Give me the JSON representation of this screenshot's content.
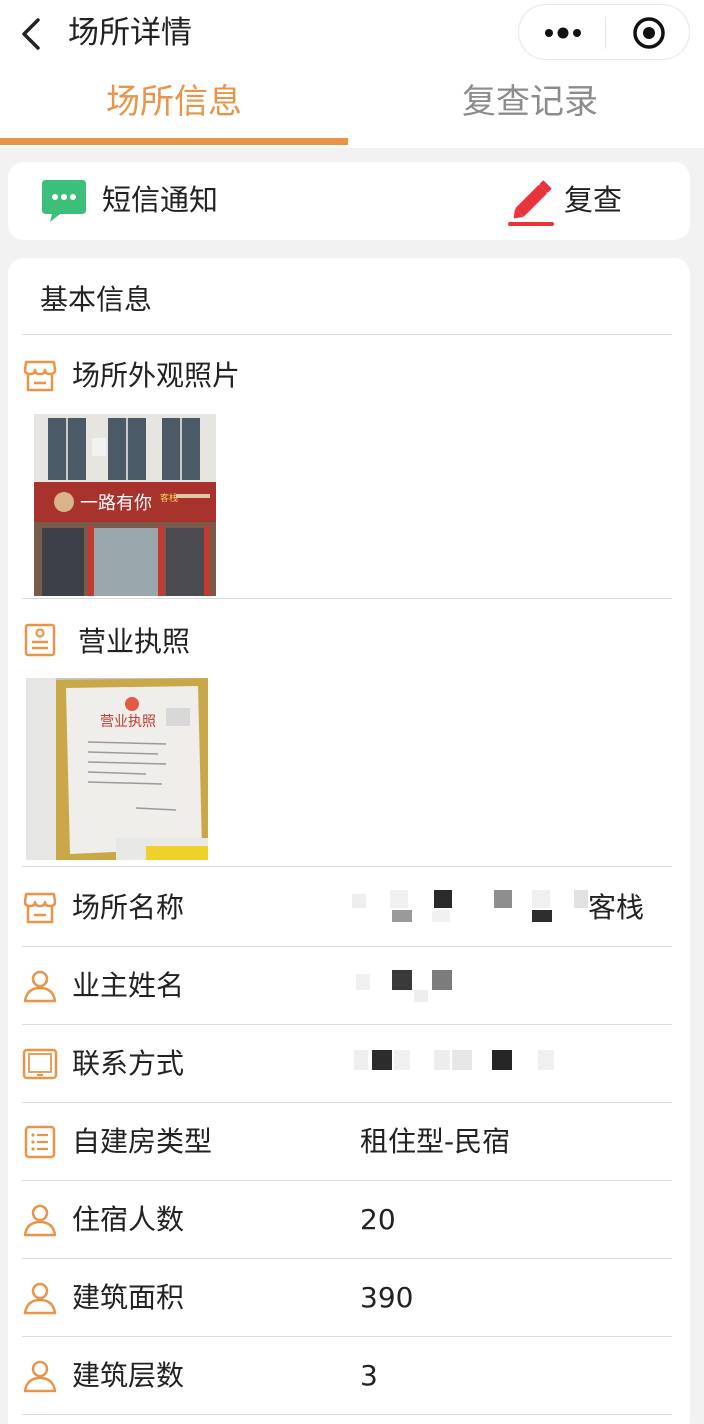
{
  "nav": {
    "title": "场所详情"
  },
  "tabs": [
    {
      "label": "场所信息"
    },
    {
      "label": "复查记录"
    }
  ],
  "actions": {
    "sms_label": "短信通知",
    "recheck_label": "复查"
  },
  "section_title": "基本信息",
  "photos": {
    "exterior_label": "场所外观照片",
    "exterior_sign_text": "一路有你",
    "exterior_sign_side": "客栈",
    "license_label": "营业执照",
    "license_doc_title": "营业执照"
  },
  "fields": [
    {
      "label": "场所名称",
      "value": "客栈",
      "icon": "store-icon"
    },
    {
      "label": "业主姓名",
      "value": "",
      "icon": "person-icon"
    },
    {
      "label": "联系方式",
      "value": "",
      "icon": "tablet-icon"
    },
    {
      "label": "自建房类型",
      "value": "租住型-民宿",
      "icon": "list-icon"
    },
    {
      "label": "住宿人数",
      "value": "20",
      "icon": "person-icon"
    },
    {
      "label": "建筑面积",
      "value": "390",
      "icon": "person-icon"
    },
    {
      "label": "建筑层数",
      "value": "3",
      "icon": "person-icon"
    }
  ],
  "colors": {
    "accent": "#e8954a",
    "sms_green": "#3cbf7a",
    "edit_red": "#e8333a"
  }
}
